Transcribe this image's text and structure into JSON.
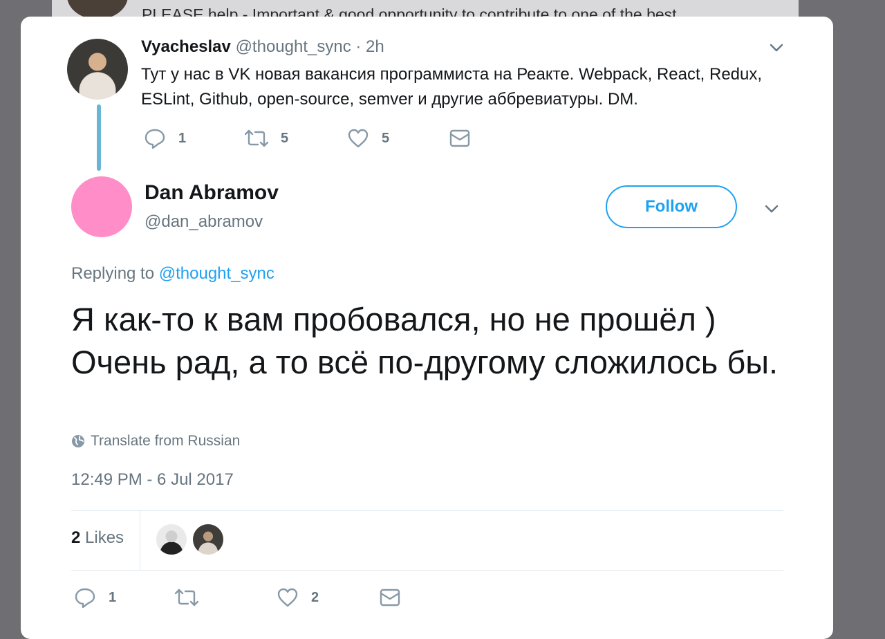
{
  "background": {
    "tweet_text": "PLEASE help - Important & good opportunity to contribute to one of the best"
  },
  "parent_tweet": {
    "name": "Vyacheslav",
    "handle": "@thought_sync",
    "separator": "·",
    "time": "2h",
    "text": "Тут у нас в VK новая вакансия программиста на Реакте. Webpack, React, Redux, ESLint, Github, open-source, semver и другие аббревиатуры. DM.",
    "actions": {
      "reply_count": "1",
      "retweet_count": "5",
      "like_count": "5"
    }
  },
  "main_tweet": {
    "name": "Dan Abramov",
    "handle": "@dan_abramov",
    "follow_label": "Follow",
    "replying_prefix": "Replying to",
    "replying_to": "@thought_sync",
    "text": "Я как-то к вам пробовался, но не прошёл ) Очень рад, а то всё по-другому сложилось бы.",
    "translate_label": "Translate from Russian",
    "timestamp": "12:49 PM - 6 Jul 2017",
    "likes_count": "2",
    "likes_label": "Likes",
    "actions": {
      "reply_count": "1",
      "retweet_count": "",
      "like_count": "2"
    }
  },
  "colors": {
    "accent": "#1da1f2",
    "thread_line": "#6ab5d6",
    "avatar_pink": "#ff8dc7",
    "secondary_text": "#66757f",
    "overlay": "#6f6f73"
  },
  "icons": [
    "chevron-down-icon",
    "reply-icon",
    "retweet-icon",
    "heart-icon",
    "envelope-icon",
    "globe-icon"
  ]
}
